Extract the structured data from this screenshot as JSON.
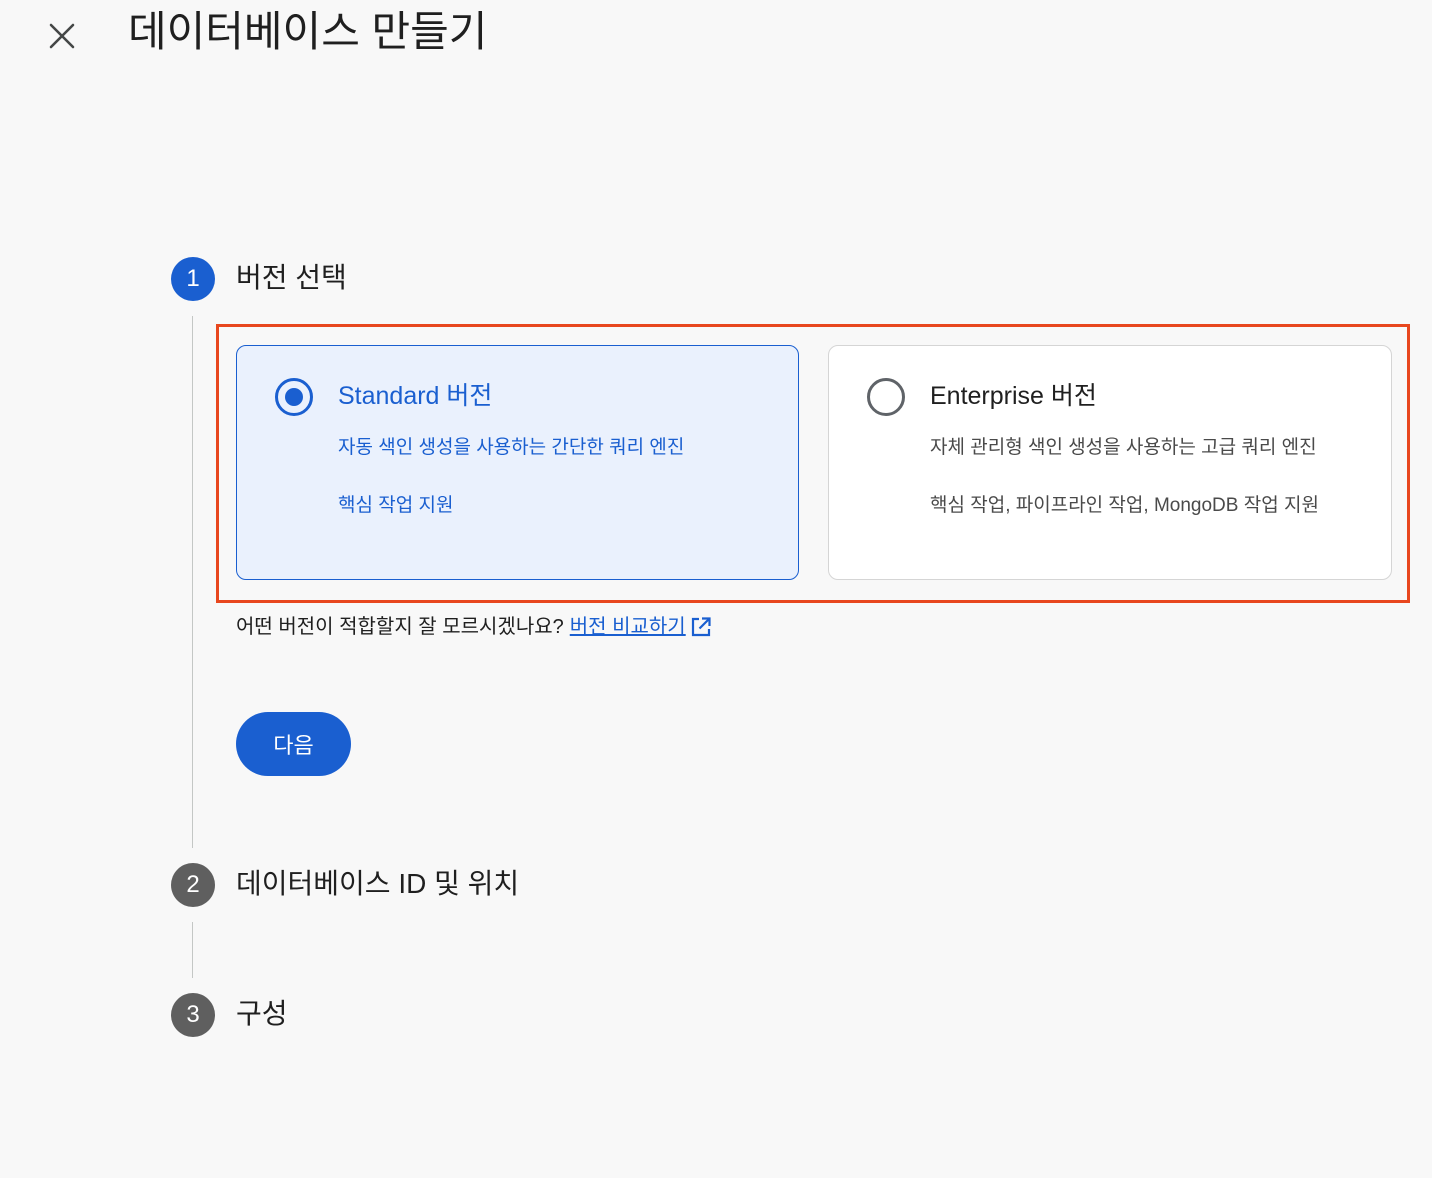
{
  "header": {
    "title": "데이터베이스 만들기",
    "close_icon": "close-icon"
  },
  "steps": [
    {
      "number": "1",
      "label": "버전 선택",
      "state": "active",
      "color": "#1a5fd0"
    },
    {
      "number": "2",
      "label": "데이터베이스 ID 및 위치",
      "state": "pending",
      "color": "#5f5f5f"
    },
    {
      "number": "3",
      "label": "구성",
      "state": "pending",
      "color": "#5f5f5f"
    }
  ],
  "editions": [
    {
      "title": "Standard 버전",
      "description": "자동 색인 생성을 사용하는 간단한 쿼리 엔진",
      "features": "핵심 작업 지원",
      "selected": true
    },
    {
      "title": "Enterprise 버전",
      "description": "자체 관리형 색인 생성을 사용하는 고급 쿼리 엔진",
      "features": "핵심 작업, 파이프라인 작업, MongoDB 작업 지원",
      "selected": false
    }
  ],
  "help": {
    "text": "어떤 버전이 적합할지 잘 모르시겠나요?",
    "link": "버전 비교하기",
    "link_icon": "external-link-icon"
  },
  "next_button": "다음",
  "colors": {
    "accent": "#1a5fd0",
    "highlight": "#e8471e",
    "selected_card_bg": "#eaf1fd",
    "pending_step": "#5f5f5f"
  }
}
